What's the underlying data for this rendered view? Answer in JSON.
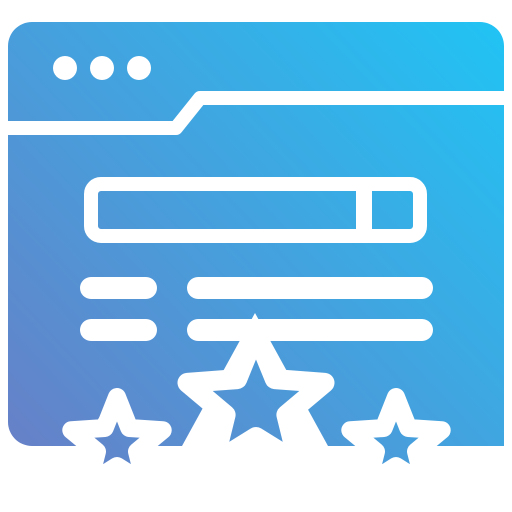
{
  "icon": {
    "name": "website-rating-icon",
    "gradient": {
      "start": "#6a7dc5",
      "end": "#1ec6f6"
    },
    "foreground": "#ffffff",
    "window_dots": 3,
    "stars": 3
  }
}
